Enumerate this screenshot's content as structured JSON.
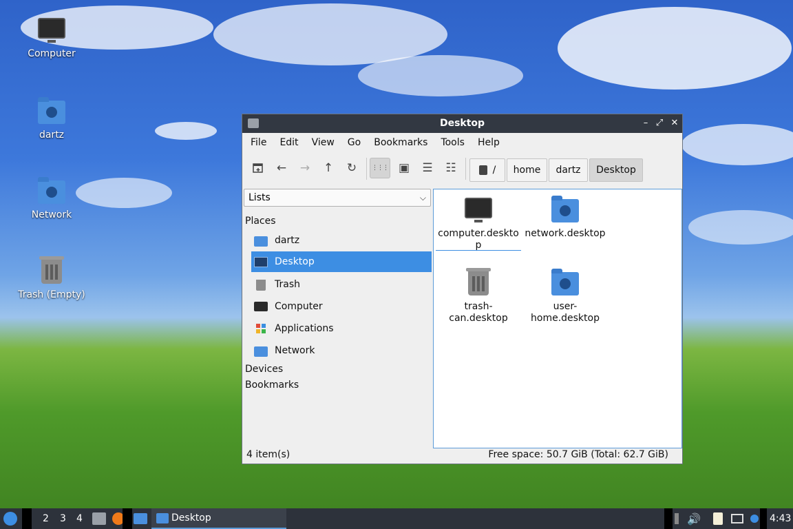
{
  "desktop": {
    "icons": [
      {
        "label": "Computer",
        "icon": "computer-icon"
      },
      {
        "label": "dartz",
        "icon": "home-folder-icon"
      },
      {
        "label": "Network",
        "icon": "network-folder-icon"
      },
      {
        "label": "Trash (Empty)",
        "icon": "trash-icon"
      }
    ]
  },
  "window": {
    "title": "Desktop",
    "controls": {
      "minimize": "–",
      "maximize": "⤢",
      "close": "✕"
    },
    "menu": [
      "File",
      "Edit",
      "View",
      "Go",
      "Bookmarks",
      "Tools",
      "Help"
    ],
    "toolbar": {
      "new_tab": "new-tab-icon",
      "back": "←",
      "forward": "→",
      "up": "↑",
      "reload": "↻",
      "view_icons": "⋮⋮⋮",
      "view_thumbnails": "▣",
      "view_compact": "☰",
      "view_detailed": "☷"
    },
    "path": {
      "root": "/",
      "segments": [
        "home",
        "dartz",
        "Desktop"
      ]
    },
    "sidebar": {
      "mode": "Lists",
      "places_header": "Places",
      "places": [
        {
          "label": "dartz",
          "icon": "home-folder-icon"
        },
        {
          "label": "Desktop",
          "icon": "desktop-icon",
          "selected": true
        },
        {
          "label": "Trash",
          "icon": "trash-icon"
        },
        {
          "label": "Computer",
          "icon": "computer-icon"
        },
        {
          "label": "Applications",
          "icon": "applications-icon"
        },
        {
          "label": "Network",
          "icon": "network-folder-icon"
        }
      ],
      "devices_header": "Devices",
      "bookmarks_header": "Bookmarks"
    },
    "files": [
      {
        "line1": "computer.deskto",
        "line2": "p",
        "icon": "computer-icon"
      },
      {
        "line1": "network.desktop",
        "line2": "",
        "icon": "network-folder-icon"
      },
      {
        "line1": "trash-",
        "line2": "can.desktop",
        "icon": "trash-icon"
      },
      {
        "line1": "user-",
        "line2": "home.desktop",
        "icon": "home-folder-icon"
      }
    ],
    "status": {
      "count": "4 item(s)",
      "free_space": "Free space: 50.7 GiB (Total: 62.7 GiB)"
    }
  },
  "taskbar": {
    "workspaces": [
      "2",
      "3",
      "4"
    ],
    "active_task": "Desktop",
    "clock": "4:43"
  },
  "colors": {
    "accent": "#3d8ee3",
    "titlebar": "#323842",
    "taskbar": "#2d323b",
    "folder": "#4a8fde"
  }
}
